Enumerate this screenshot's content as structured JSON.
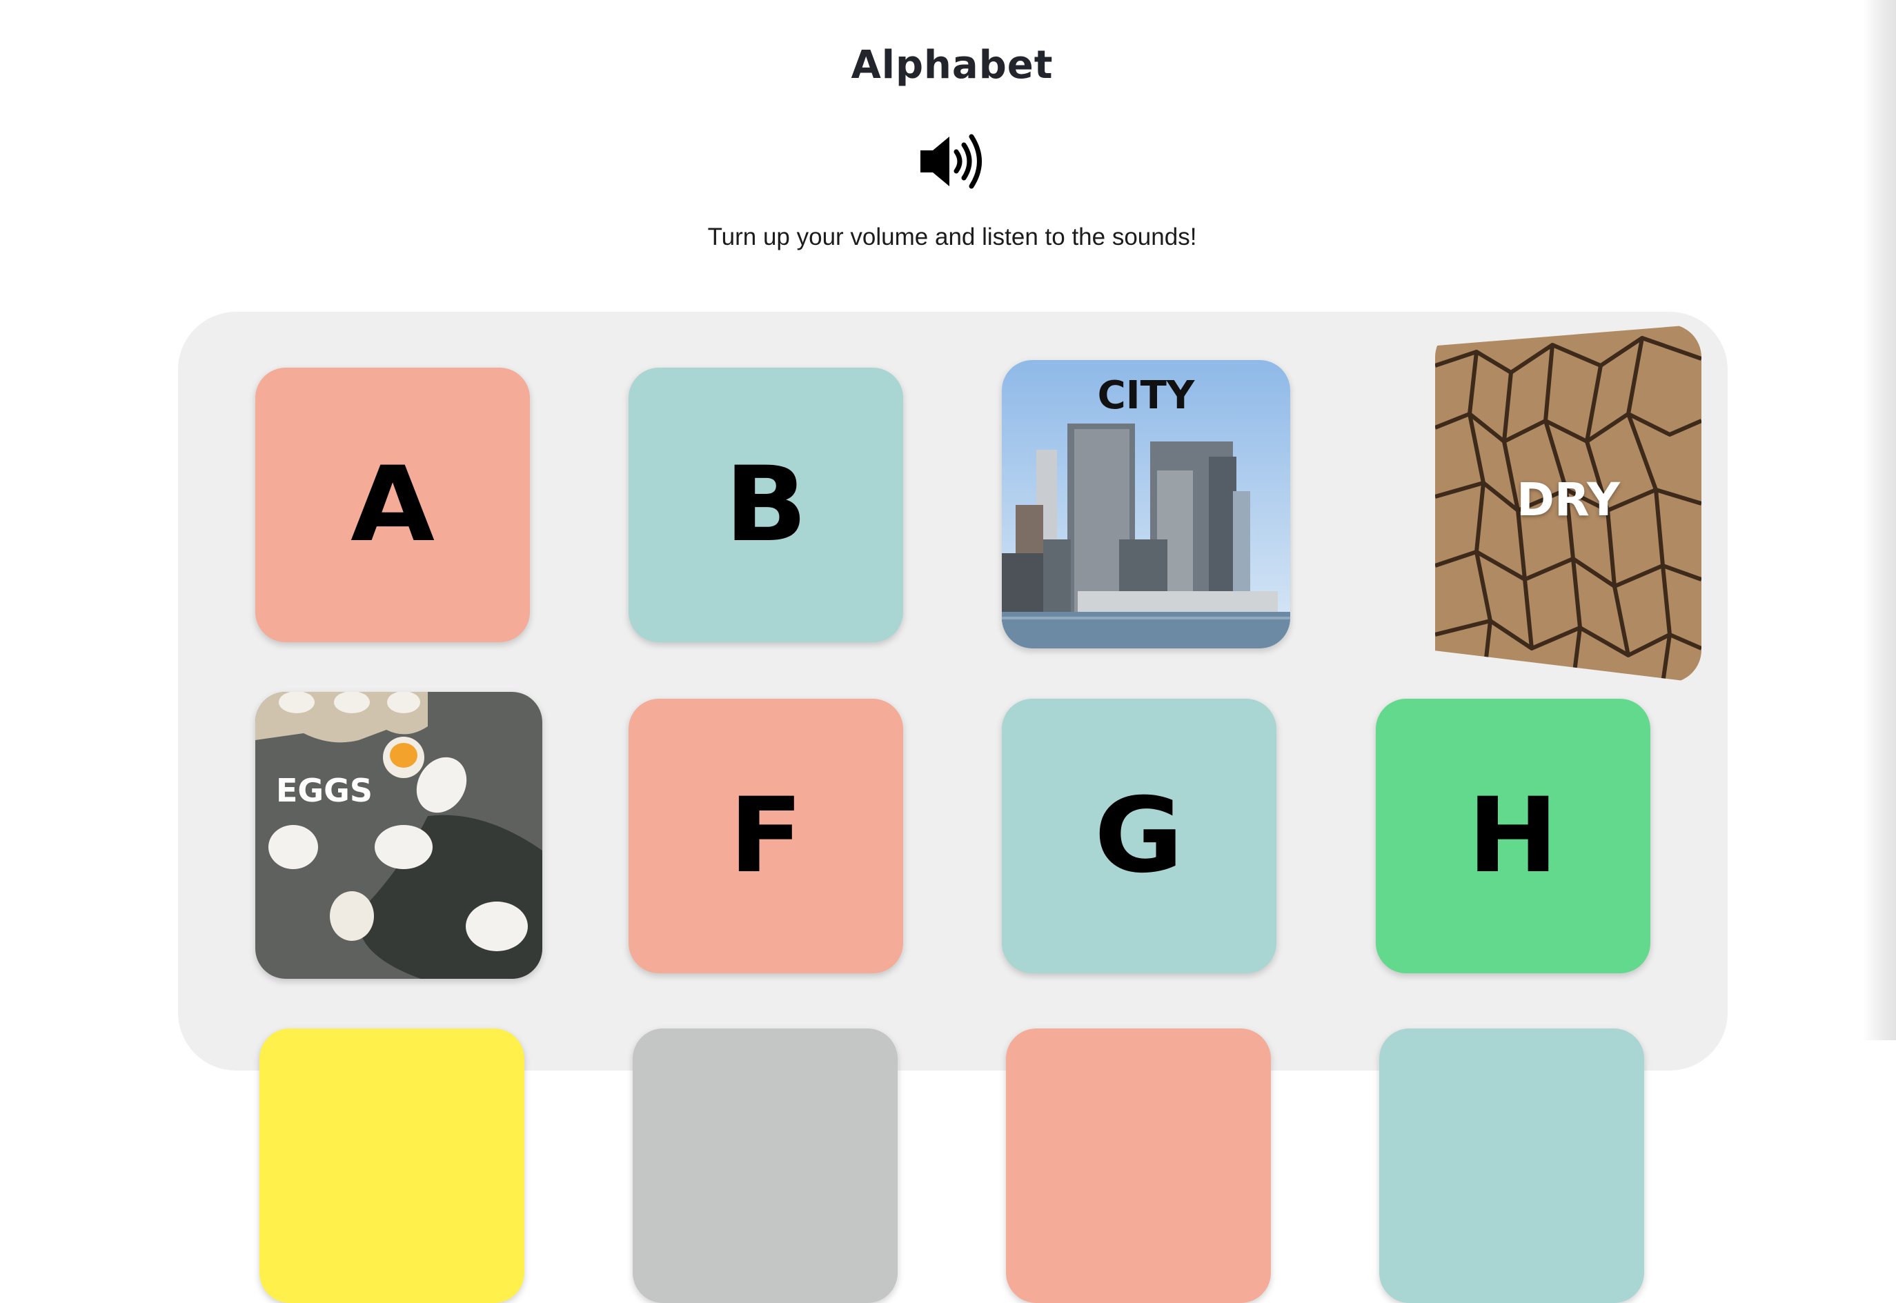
{
  "page": {
    "title": "Alphabet",
    "subtitle": "Turn up your volume and listen to the sounds!"
  },
  "icons": {
    "sound": "speaker-volume-icon"
  },
  "colors": {
    "pink": "#f4ab98",
    "teal": "#a9d5d3",
    "green": "#62d98d",
    "yellow": "#fff04c",
    "grey": "#c3c6c4",
    "board": "#efefef"
  },
  "cards": [
    {
      "letter": "A",
      "color": "pink"
    },
    {
      "letter": "B",
      "color": "teal"
    },
    {
      "word": "CITY",
      "image": "city-skyline"
    },
    {
      "word": "DRY",
      "image": "cracked-dry-earth"
    },
    {
      "word": "EGGS",
      "image": "eggs-carton"
    },
    {
      "letter": "F",
      "color": "pink"
    },
    {
      "letter": "G",
      "color": "teal"
    },
    {
      "letter": "H",
      "color": "green"
    },
    {
      "color": "yellow"
    },
    {
      "color": "grey"
    },
    {
      "color": "pink"
    },
    {
      "color": "teal"
    }
  ]
}
